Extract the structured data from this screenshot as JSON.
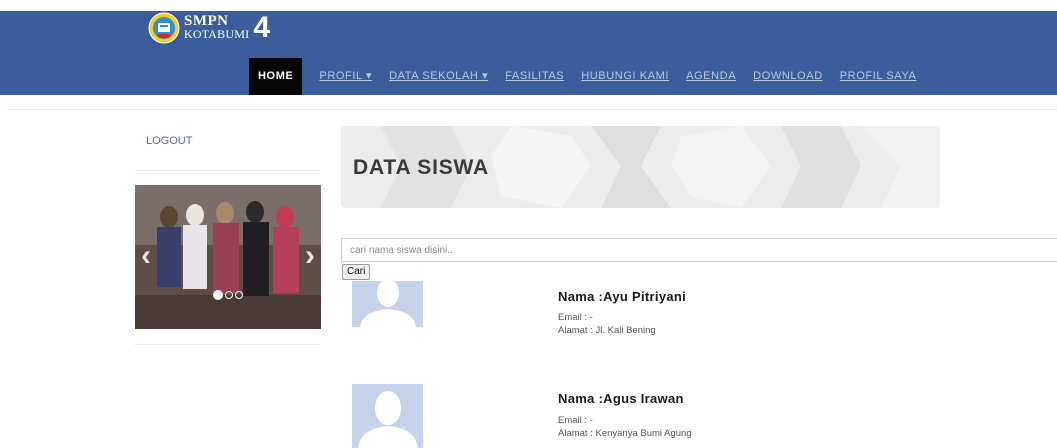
{
  "brand": {
    "line1": "SMPN",
    "line2": "KOTABUMI",
    "number": "4"
  },
  "nav": {
    "items": [
      {
        "label": "HOME"
      },
      {
        "label": "PROFIL ▾"
      },
      {
        "label": "DATA SEKOLAH ▾"
      },
      {
        "label": "FASILITAS"
      },
      {
        "label": "HUBUNGI KAMI"
      },
      {
        "label": "AGENDA"
      },
      {
        "label": "DOWNLOAD"
      },
      {
        "label": "PROFIL SAYA"
      }
    ]
  },
  "sidebar": {
    "logout_label": "LOGOUT",
    "slider": {
      "prev_icon": "chevron-left-icon",
      "next_icon": "chevron-right-icon",
      "slides": 3,
      "active_slide": 1
    }
  },
  "banner": {
    "title": "DATA SISWA"
  },
  "search": {
    "placeholder": "cari nama siswa disini..",
    "value": "",
    "button_label": "Cari"
  },
  "students": [
    {
      "name": "Nama :Ayu Pitriyani",
      "email": "Email : -",
      "address": "Alamat : Jl. Kali Bening"
    },
    {
      "name": "Nama :Agus Irawan",
      "email": "Email : -",
      "address": "Alamat : Kenyanya Bumi Agung"
    }
  ],
  "colors": {
    "navbar": "#3c5d9c",
    "home_active": "#050505",
    "nav_link": "#b9c6e3",
    "avatar_bg": "#c4d3ea"
  }
}
